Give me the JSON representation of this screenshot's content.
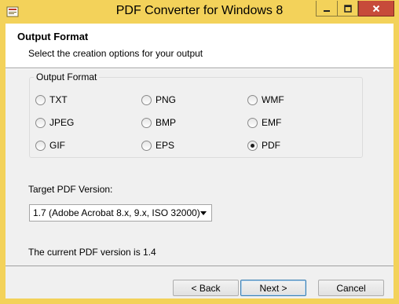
{
  "window": {
    "title": "PDF Converter for Windows 8",
    "colors": {
      "frame": "#f3d25a",
      "close": "#c74b3a"
    }
  },
  "header": {
    "title": "Output Format",
    "subtitle": "Select the creation options for your output"
  },
  "format_group": {
    "label": "Output Format",
    "options": [
      {
        "label": "TXT",
        "checked": false
      },
      {
        "label": "PNG",
        "checked": false
      },
      {
        "label": "WMF",
        "checked": false
      },
      {
        "label": "JPEG",
        "checked": false
      },
      {
        "label": "BMP",
        "checked": false
      },
      {
        "label": "EMF",
        "checked": false
      },
      {
        "label": "GIF",
        "checked": false
      },
      {
        "label": "EPS",
        "checked": false
      },
      {
        "label": "PDF",
        "checked": true
      }
    ]
  },
  "pdf_version": {
    "label": "Target PDF Version:",
    "selected": "1.7 (Adobe Acrobat 8.x, 9.x, ISO 32000)"
  },
  "status": {
    "current_version_text": "The current PDF version is 1.4"
  },
  "buttons": {
    "back": "< Back",
    "next": "Next >",
    "cancel": "Cancel"
  }
}
